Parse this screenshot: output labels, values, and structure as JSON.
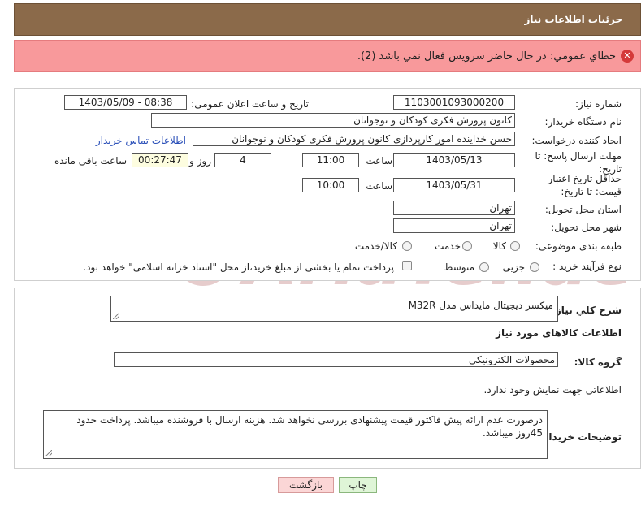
{
  "header": {
    "title": "جزئیات اطلاعات نیاز"
  },
  "alert": {
    "text": "خطاي عمومي: در حال حاضر سرويس فعال نمي باشد (2)."
  },
  "form": {
    "need_number_label": "شماره نیاز:",
    "need_number": "1103001093000200",
    "announce_label": "تاریخ و ساعت اعلان عمومی:",
    "announce_value": "1403/05/09 - 08:38",
    "buyer_label": "نام دستگاه خریدار:",
    "buyer_value": "کانون پرورش فکری کودکان و نوجوانان",
    "creator_label": "ایجاد کننده درخواست:",
    "creator_value": "حسن خداینده امور کارپردازی  کانون پرورش فکری کودکان و نوجوانان",
    "contact_link": "اطلاعات تماس خریدار",
    "reply_label": "مهلت ارسال پاسخ: تا تاریخ:",
    "reply_date": "1403/05/13",
    "time_label": "ساعت",
    "reply_time": "11:00",
    "days_value": "4",
    "days_label": "روز و",
    "countdown": "00:27:47",
    "remaining_label": "ساعت باقی مانده",
    "validity_label": "حداقل تاریخ اعتبار قیمت: تا تاریخ:",
    "validity_date": "1403/05/31",
    "validity_time": "10:00",
    "province_label": "استان محل تحویل:",
    "province_value": "تهران",
    "city_label": "شهر محل تحویل:",
    "city_value": "تهران",
    "category_label": "طبقه بندی موضوعی:",
    "category_options": [
      "کالا",
      "خدمت",
      "کالا/خدمت"
    ],
    "process_label": "نوع فرآیند خرید :",
    "process_options": [
      "جزیی",
      "متوسط"
    ],
    "payment_note": "پرداخت تمام یا بخشی از مبلغ خرید،از محل \"اسناد خزانه اسلامی\" خواهد بود."
  },
  "details": {
    "summary_label": "شرح کلي نياز:",
    "summary_value": "میکسر دیجیتال مایداس مدل M32R",
    "goods_title": "اطلاعات کالاهای مورد نیاز",
    "group_label": "گروه کالا:",
    "group_value": "محصولات الکترونیکی",
    "no_info": "اطلاعاتی جهت نمایش وجود ندارد.",
    "buyer_notes_label": "توضیحات خریدار:",
    "buyer_notes_value": "درصورت عدم ارائه پیش فاکتور قیمت پیشنهادی بررسی نخواهد شد. هزینه ارسال با فروشنده میباشد. پرداخت حدود 45روز میباشد."
  },
  "buttons": {
    "print": "چاپ",
    "back": "بازگشت"
  },
  "watermark": {
    "text": "AriaTender.net"
  },
  "colors": {
    "header_bg": "#8b6a4a",
    "alert_bg": "#f8999b",
    "watermark": "#e3c7c7"
  }
}
